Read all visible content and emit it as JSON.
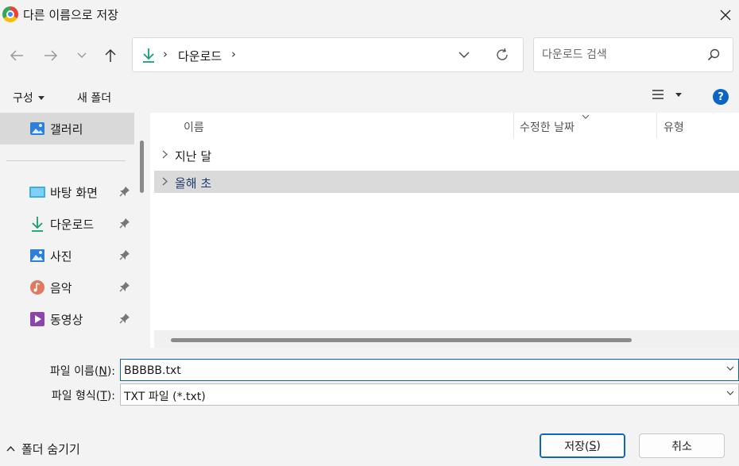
{
  "window": {
    "title": "다른 이름으로 저장"
  },
  "address_bar": {
    "crumbs": [
      "다운로드"
    ]
  },
  "search": {
    "placeholder": "다운로드 검색"
  },
  "toolbar": {
    "organize_label": "구성",
    "new_folder_label": "새 폴더"
  },
  "sidebar": {
    "items": [
      {
        "label": "갤러리",
        "icon": "gallery-icon",
        "selected": true
      },
      {
        "label": "바탕 화면",
        "icon": "desktop-icon",
        "pinned": true
      },
      {
        "label": "다운로드",
        "icon": "download-icon",
        "pinned": true
      },
      {
        "label": "사진",
        "icon": "pictures-icon",
        "pinned": true
      },
      {
        "label": "음악",
        "icon": "music-icon",
        "pinned": true
      },
      {
        "label": "동영상",
        "icon": "videos-icon",
        "pinned": true
      }
    ]
  },
  "columns": {
    "name": "이름",
    "modified": "수정한 날짜",
    "type": "유형"
  },
  "groups": [
    {
      "label": "지난 달",
      "selected": false
    },
    {
      "label": "올해 초",
      "selected": true
    }
  ],
  "filename": {
    "label": "파일 이름(",
    "accel": "N",
    "label_end": "):",
    "value": "BBBBB.txt"
  },
  "filetype": {
    "label": "파일 형식(",
    "accel": "T",
    "label_end": "):",
    "value": "TXT 파일 (*.txt)"
  },
  "footer": {
    "hide_folders_label": "폴더 숨기기",
    "save_label": "저장(",
    "save_accel": "S",
    "save_end": ")",
    "cancel_label": "취소"
  },
  "colors": {
    "accent": "#0a66c2",
    "download_green": "#1a9e6f",
    "selection": "#dadada"
  }
}
